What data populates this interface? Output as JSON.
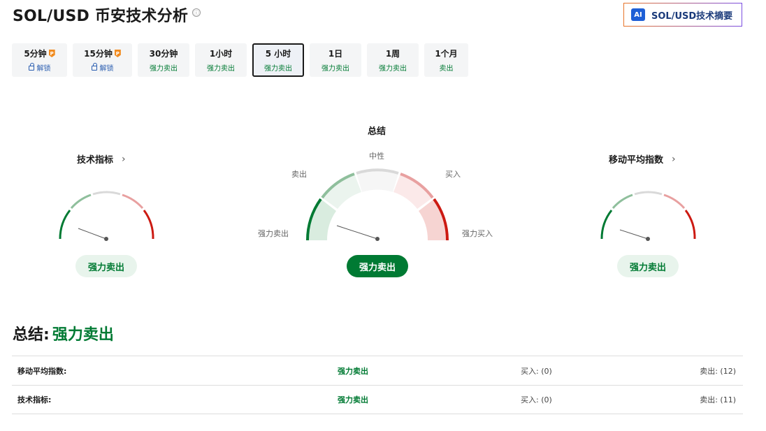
{
  "page": {
    "title": "SOL/USD 币安技术分析",
    "info_icon": "ⓘ"
  },
  "ai_button": {
    "badge": "AI",
    "label": "SOL/USD技术摘要"
  },
  "tabs": [
    {
      "label": "5分钟",
      "sub": "解锁",
      "locked": true
    },
    {
      "label": "15分钟",
      "sub": "解锁",
      "locked": true
    },
    {
      "label": "30分钟",
      "sub": "强力卖出"
    },
    {
      "label": "1小时",
      "sub": "强力卖出"
    },
    {
      "label": "5 小时",
      "sub": "强力卖出",
      "active": true
    },
    {
      "label": "1日",
      "sub": "强力卖出"
    },
    {
      "label": "1周",
      "sub": "强力卖出"
    },
    {
      "label": "1个月",
      "sub": "卖出"
    }
  ],
  "gauges": {
    "left": {
      "title": "技术指标",
      "chevron": "›",
      "result": "强力卖出"
    },
    "center": {
      "title": "总结",
      "result": "强力卖出",
      "labels": {
        "strong_sell": "强力卖出",
        "sell": "卖出",
        "neutral": "中性",
        "buy": "买入",
        "strong_buy": "强力买入"
      }
    },
    "right": {
      "title": "移动平均指数",
      "chevron": "›",
      "result": "强力卖出"
    }
  },
  "summary": {
    "label": "总结:",
    "verdict": "强力卖出"
  },
  "table": [
    {
      "name": "移动平均指数:",
      "signal": "强力卖出",
      "buy": "买入: (0)",
      "sell": "卖出: (12)"
    },
    {
      "name": "技术指标:",
      "signal": "强力卖出",
      "buy": "买入: (0)",
      "sell": "卖出: (11)"
    }
  ],
  "colors": {
    "strong_sell": "#007a33",
    "sell": "#8fbf9c",
    "neutral": "#d9d9d9",
    "buy": "#e8a0a0",
    "strong_buy": "#cc1a12"
  }
}
